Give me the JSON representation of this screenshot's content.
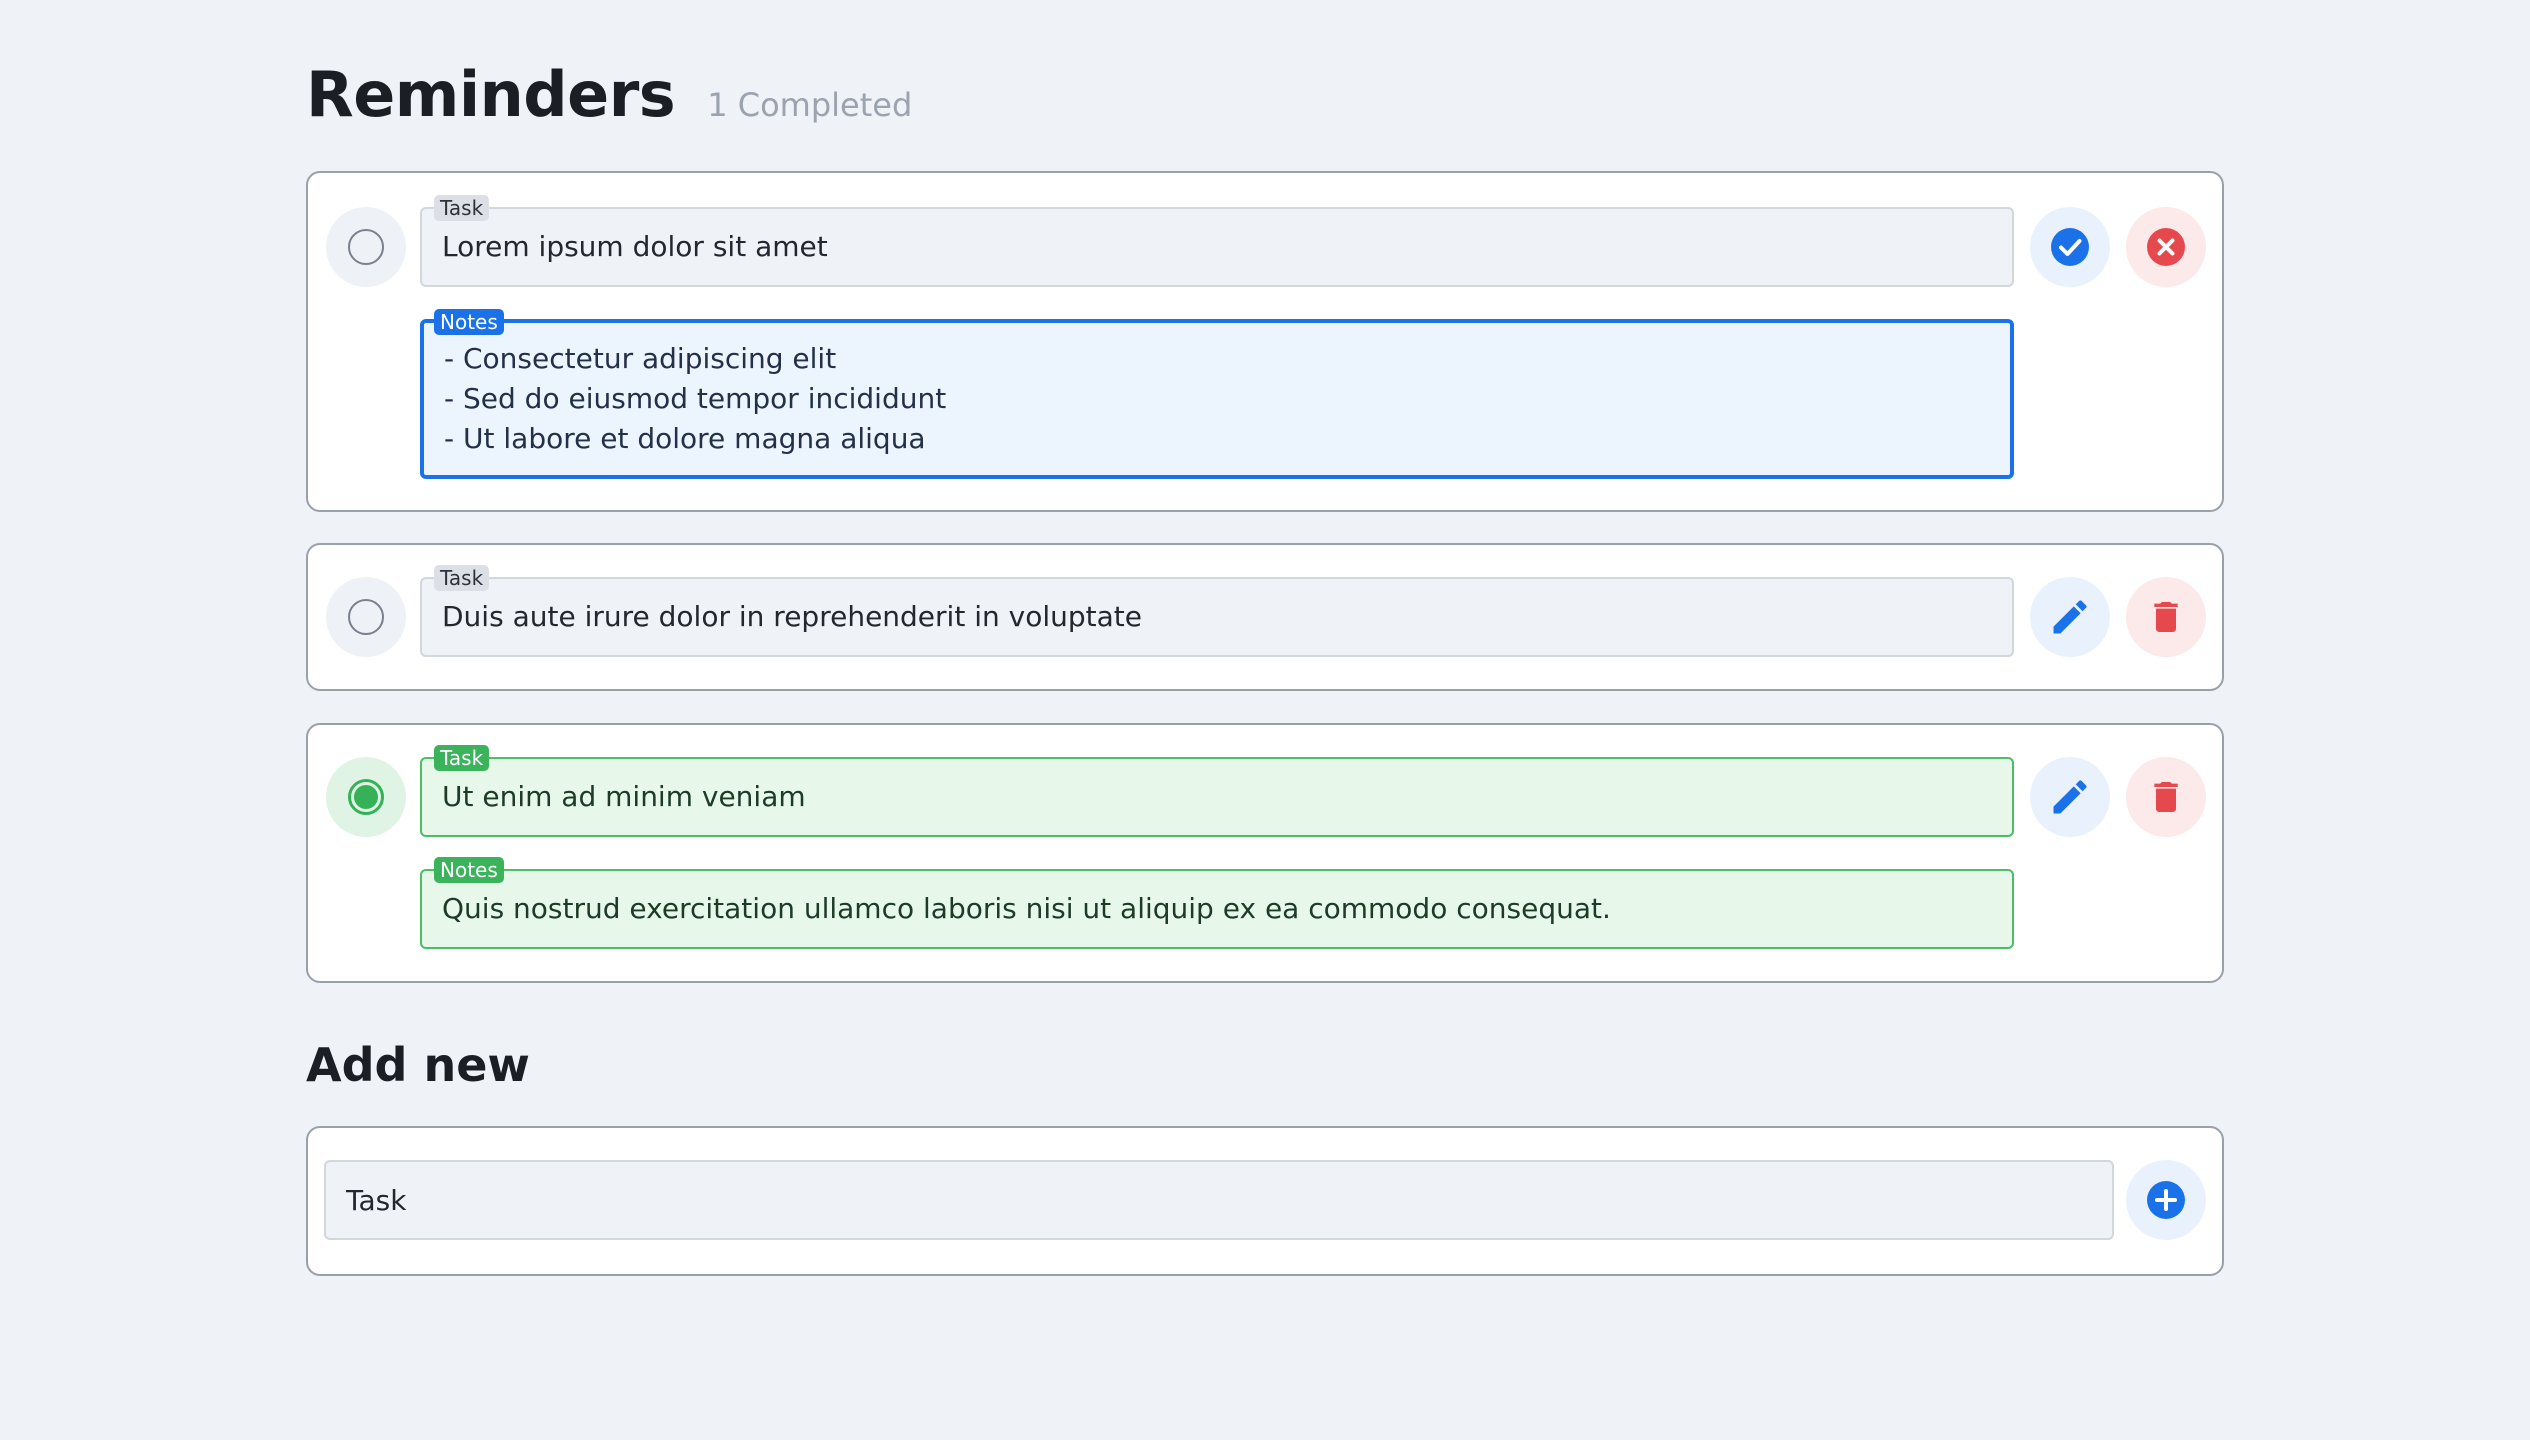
{
  "header": {
    "title": "Reminders",
    "completed": "1 Completed"
  },
  "reminders": [
    {
      "task_label": "Task",
      "task": "Lorem ipsum dolor sit amet",
      "notes_label": "Notes",
      "notes": "- Consectetur adipiscing elit\n- Sed do eiusmod tempor incididunt\n- Ut labore et dolore magna aliqua",
      "completed": false,
      "mode": "editing",
      "actions": [
        "confirm-icon",
        "cancel-icon"
      ]
    },
    {
      "task_label": "Task",
      "task": "Duis aute irure dolor in reprehenderit in voluptate",
      "completed": false,
      "mode": "view",
      "actions": [
        "pencil-icon",
        "trash-icon"
      ]
    },
    {
      "task_label": "Task",
      "task": "Ut enim ad minim veniam",
      "notes_label": "Notes",
      "notes": "Quis nostrud exercitation ullamco laboris nisi ut aliquip ex ea commodo consequat.",
      "completed": true,
      "mode": "view",
      "actions": [
        "pencil-icon",
        "trash-icon"
      ]
    }
  ],
  "add_new": {
    "heading": "Add new",
    "placeholder": "Task",
    "button_icon": "plus-circle-icon"
  },
  "colors": {
    "background": "#eff2f7",
    "accent_blue": "#1b72e8",
    "success_green": "#37b158",
    "danger_red": "#e5484d"
  }
}
